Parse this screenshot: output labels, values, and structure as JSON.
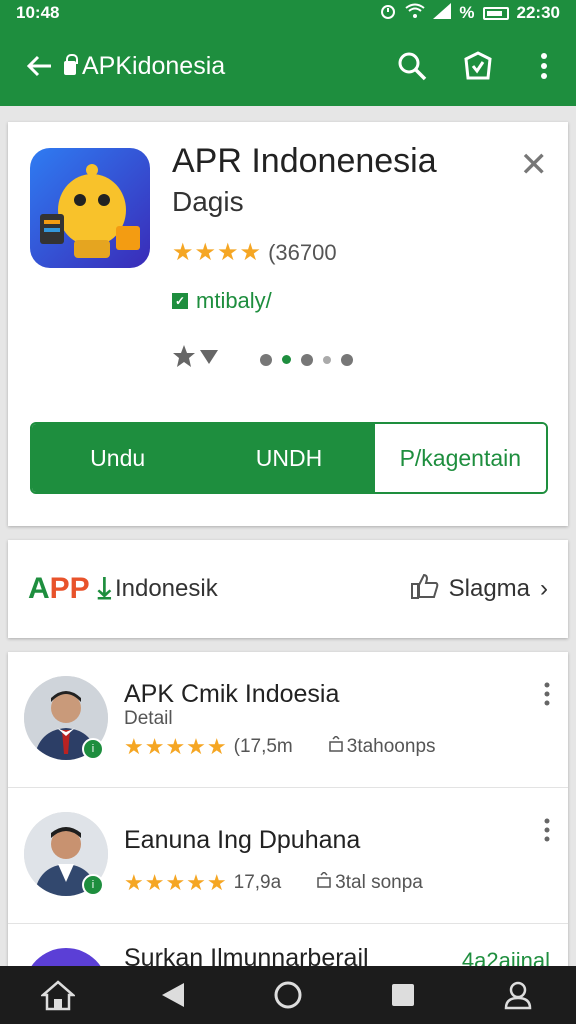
{
  "status_bar": {
    "time_left": "10:48",
    "time_right": "22:30",
    "percent_sign": "%"
  },
  "toolbar": {
    "back_icon": "arrow-left-icon",
    "title": "APKidonesia",
    "search_icon": "search-icon",
    "store_icon": "shield-store-icon",
    "menu_icon": "kebab-menu-icon"
  },
  "app_card": {
    "name": "APR Indonenesia",
    "developer": "Dagis",
    "stars": "★★★★",
    "rating_count": "(36700",
    "editor_label": "mtibaly/",
    "editor_mark": "✓",
    "close_symbol": "✕",
    "buttons": [
      {
        "label": "Undu"
      },
      {
        "label": "UNDH"
      },
      {
        "label": "P/kagentain"
      }
    ]
  },
  "brand_card": {
    "brand_a": "A",
    "brand_pp": "PP",
    "arrow": "⤓",
    "brand_name": "Indonesik",
    "share_label": "Slagma",
    "share_arrow": "›"
  },
  "list": {
    "items": [
      {
        "title": "APK Cmik Indoesia",
        "sub": "Detail",
        "stars": "★★★★★",
        "count": "(17,5m",
        "downloads": "3tahoonps",
        "badge": "i"
      },
      {
        "title": "Eanuna Ing Dpuhana",
        "sub": "",
        "stars": "★★★★★",
        "count": "17,9a",
        "downloads": "3tal sonpa",
        "badge": "i"
      },
      {
        "title": "Surkan Ilmunnarberail",
        "sub": "",
        "stars": "",
        "count": "",
        "downloads": "",
        "badge": "",
        "trailing": "4a2aiinal"
      }
    ]
  },
  "nav": {
    "home_icon": "home-icon",
    "back_icon": "triangle-back-icon",
    "circle_icon": "circle-home-icon",
    "square_icon": "square-recents-icon",
    "person_icon": "person-icon"
  },
  "colors": {
    "primary": "#1e8e3e",
    "accent_star": "#f5a623",
    "brand_orange": "#e8532b"
  }
}
